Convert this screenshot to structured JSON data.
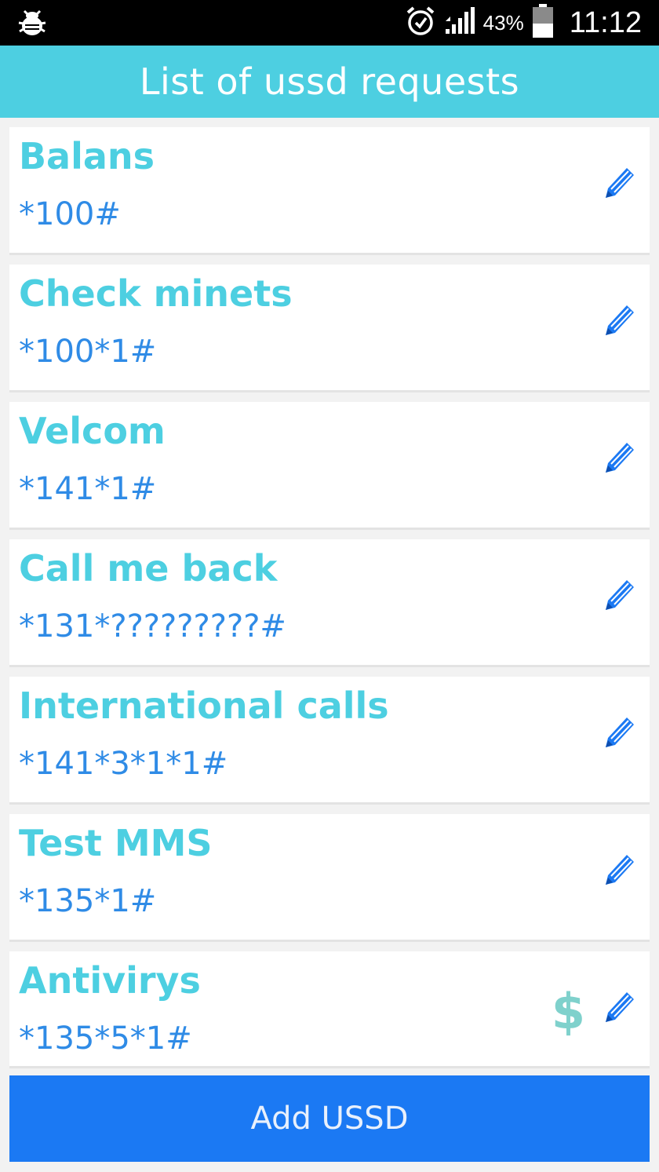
{
  "status_bar": {
    "battery_percent": "43%",
    "time": "11:12",
    "icons": [
      "debug-bug-icon",
      "alarm-clock-icon",
      "signal-icon",
      "battery-icon"
    ]
  },
  "app_bar": {
    "title": "List of ussd requests"
  },
  "requests": [
    {
      "name": "Balans",
      "code": "*100#",
      "paid": false
    },
    {
      "name": "Check minets",
      "code": "*100*1#",
      "paid": false
    },
    {
      "name": "Velcom",
      "code": "*141*1#",
      "paid": false
    },
    {
      "name": "Call me back",
      "code": "*131*?????????#",
      "paid": false
    },
    {
      "name": "International calls",
      "code": "*141*3*1*1#",
      "paid": false
    },
    {
      "name": "Test MMS",
      "code": "*135*1#",
      "paid": false
    },
    {
      "name": "Antivirys",
      "code": "*135*5*1#",
      "paid": true,
      "paid_symbol": "$"
    }
  ],
  "add_button": {
    "label": "Add USSD"
  },
  "colors": {
    "accent": "#4dcfe1",
    "code_text": "#2f8be6",
    "button": "#1b79f3",
    "paid_symbol": "#7fd1cc"
  }
}
